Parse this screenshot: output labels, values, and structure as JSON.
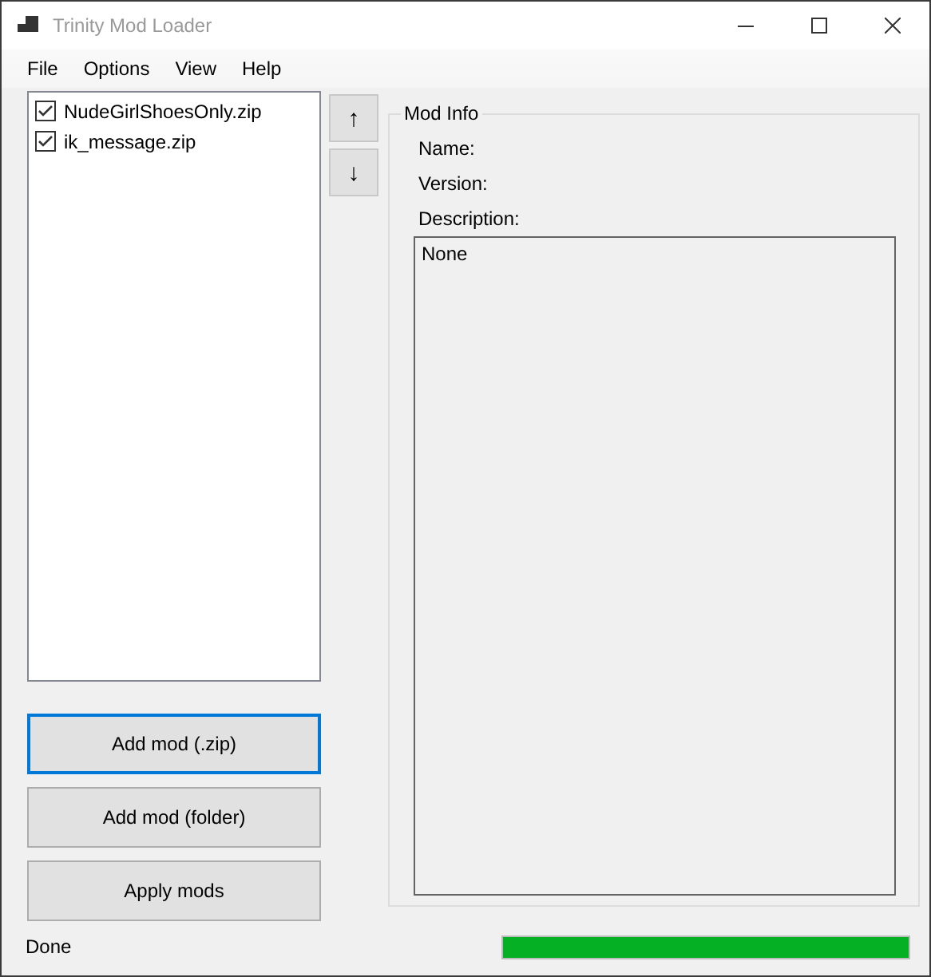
{
  "window": {
    "title": "Trinity Mod Loader",
    "active": false
  },
  "menu": [
    "File",
    "Options",
    "View",
    "Help"
  ],
  "mods": [
    {
      "name": "NudeGirlShoesOnly.zip",
      "checked": true
    },
    {
      "name": "ik_message.zip",
      "checked": true
    }
  ],
  "move_buttons": [
    "↑",
    "↓"
  ],
  "mod_info": {
    "title": "Mod Info",
    "name_label": "Name:",
    "version_label": "Version:",
    "description_label": "Description:",
    "description": "None"
  },
  "buttons": [
    {
      "label": "Add mod (.zip)",
      "focused": true
    },
    {
      "label": "Add mod (folder)",
      "focused": false
    },
    {
      "label": "Apply mods",
      "focused": false
    }
  ],
  "status": {
    "text": "Done",
    "level": 1
  }
}
